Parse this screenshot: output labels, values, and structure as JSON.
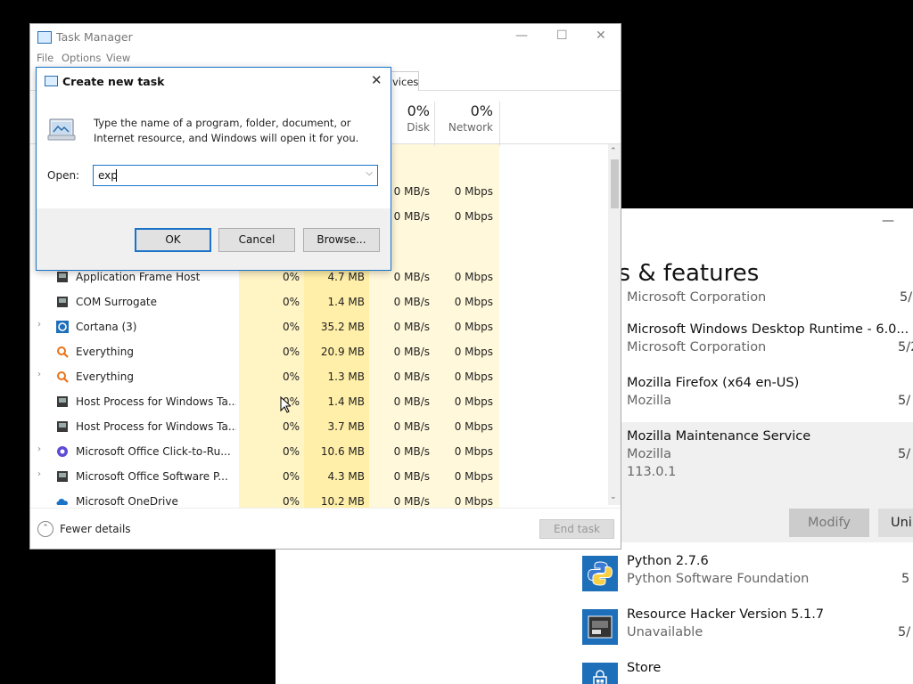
{
  "apps_window": {
    "title": "ps & features",
    "minimize": "—",
    "rows": [
      {
        "name": "",
        "publisher": "Microsoft Corporation",
        "version": "",
        "date": "5/"
      },
      {
        "name": "Microsoft Windows Desktop Runtime - 6.0...",
        "publisher": "Microsoft Corporation",
        "version": "",
        "date": "5/2"
      },
      {
        "name": "Mozilla Firefox (x64 en-US)",
        "publisher": "Mozilla",
        "version": "",
        "date": "5/"
      },
      {
        "name": "Mozilla Maintenance Service",
        "publisher": "Mozilla",
        "version": "113.0.1",
        "date": "5/"
      },
      {
        "name": "Python 2.7.6",
        "publisher": "Python Software Foundation",
        "version": "",
        "date": "5"
      },
      {
        "name": "Resource Hacker Version 5.1.7",
        "publisher": "Unavailable",
        "version": "",
        "date": "5/"
      },
      {
        "name": "Store",
        "publisher": "",
        "version": "",
        "date": ""
      }
    ],
    "modify_label": "Modify",
    "uninstall_label": "Uni"
  },
  "task_manager": {
    "title": "Task Manager",
    "menu": [
      "File",
      "Options",
      "View"
    ],
    "window_controls": {
      "minimize": "—",
      "maximize": "☐",
      "close": "✕"
    },
    "visible_tab": "vices",
    "columns": {
      "disk": {
        "pct": "0%",
        "label": "Disk"
      },
      "network": {
        "pct": "0%",
        "label": "Network"
      }
    },
    "partial_rows": [
      {
        "disk": "0 MB/s",
        "network": "0 Mbps"
      },
      {
        "disk": "0 MB/s",
        "network": "0 Mbps"
      }
    ],
    "processes": [
      {
        "expand": "",
        "icon": "app-frame",
        "name": "Application Frame Host",
        "cpu": "0%",
        "memory": "4.7 MB",
        "disk": "0 MB/s",
        "network": "0 Mbps"
      },
      {
        "expand": "",
        "icon": "app-frame",
        "name": "COM Surrogate",
        "cpu": "0%",
        "memory": "1.4 MB",
        "disk": "0 MB/s",
        "network": "0 Mbps"
      },
      {
        "expand": "›",
        "icon": "cortana",
        "name": "Cortana (3)",
        "cpu": "0%",
        "memory": "35.2 MB",
        "disk": "0 MB/s",
        "network": "0 Mbps"
      },
      {
        "expand": "",
        "icon": "everything",
        "name": "Everything",
        "cpu": "0%",
        "memory": "20.9 MB",
        "disk": "0 MB/s",
        "network": "0 Mbps"
      },
      {
        "expand": "›",
        "icon": "everything",
        "name": "Everything",
        "cpu": "0%",
        "memory": "1.3 MB",
        "disk": "0 MB/s",
        "network": "0 Mbps"
      },
      {
        "expand": "",
        "icon": "app-frame",
        "name": "Host Process for Windows Ta...",
        "cpu": "0%",
        "memory": "1.4 MB",
        "disk": "0 MB/s",
        "network": "0 Mbps"
      },
      {
        "expand": "",
        "icon": "app-frame",
        "name": "Host Process for Windows Ta...",
        "cpu": "0%",
        "memory": "3.7 MB",
        "disk": "0 MB/s",
        "network": "0 Mbps"
      },
      {
        "expand": "›",
        "icon": "office",
        "name": "Microsoft Office Click-to-Ru...",
        "cpu": "0%",
        "memory": "10.6 MB",
        "disk": "0 MB/s",
        "network": "0 Mbps"
      },
      {
        "expand": "›",
        "icon": "app-frame",
        "name": "Microsoft Office Software P...",
        "cpu": "0%",
        "memory": "4.3 MB",
        "disk": "0 MB/s",
        "network": "0 Mbps"
      },
      {
        "expand": "",
        "icon": "onedrive",
        "name": "Microsoft OneDrive",
        "cpu": "0%",
        "memory": "10.2 MB",
        "disk": "0 MB/s",
        "network": "0 Mbps"
      }
    ],
    "fewer_details": "Fewer details",
    "end_task": "End task"
  },
  "run_dialog": {
    "title": "Create new task",
    "close": "✕",
    "description": "Type the name of a program, folder, document, or Internet resource, and Windows will open it for you.",
    "open_label": "Open:",
    "open_value": "exp",
    "ok": "OK",
    "cancel": "Cancel",
    "browse": "Browse..."
  },
  "colors": {
    "accent": "#1a73c8",
    "heat_column": "#fff4c4",
    "selected_row": "#f0f0f0"
  }
}
